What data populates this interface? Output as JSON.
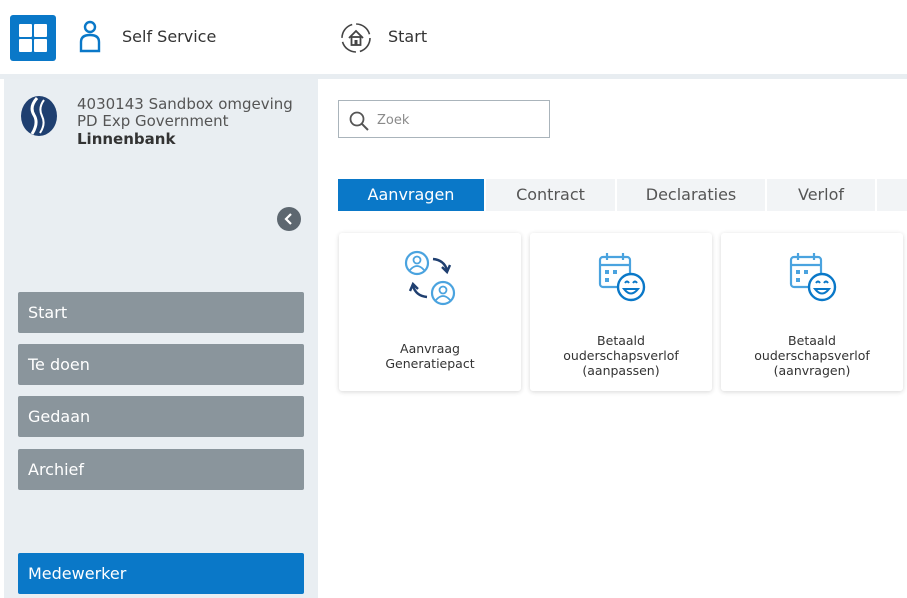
{
  "header": {
    "app_label": "Self Service",
    "page_label": "Start"
  },
  "sidebar": {
    "org": {
      "line1": "4030143 Sandbox omgeving",
      "line2": "PD Exp Government",
      "line3": "Linnenbank"
    },
    "nav": [
      "Start",
      "Te doen",
      "Gedaan",
      "Archief"
    ],
    "role_button": "Medewerker"
  },
  "search": {
    "placeholder": "Zoek"
  },
  "tabs": [
    "Aanvragen",
    "Contract",
    "Declaraties",
    "Verlof"
  ],
  "active_tab": "Aanvragen",
  "cards": [
    {
      "icon": "exchange-persons-icon",
      "lines": [
        "Aanvraag",
        "Generatiepact"
      ]
    },
    {
      "icon": "calendar-smile-icon",
      "lines": [
        "Betaald",
        "ouderschapsverlof",
        "(aanpassen)"
      ]
    },
    {
      "icon": "calendar-smile-icon",
      "lines": [
        "Betaald",
        "ouderschapsverlof",
        "(aanvragen)"
      ]
    }
  ],
  "colors": {
    "accent": "#0a78c8",
    "nav_button": "#8a959c",
    "sidebar_bg": "#e9eef2",
    "icon": "#4aa3df"
  }
}
